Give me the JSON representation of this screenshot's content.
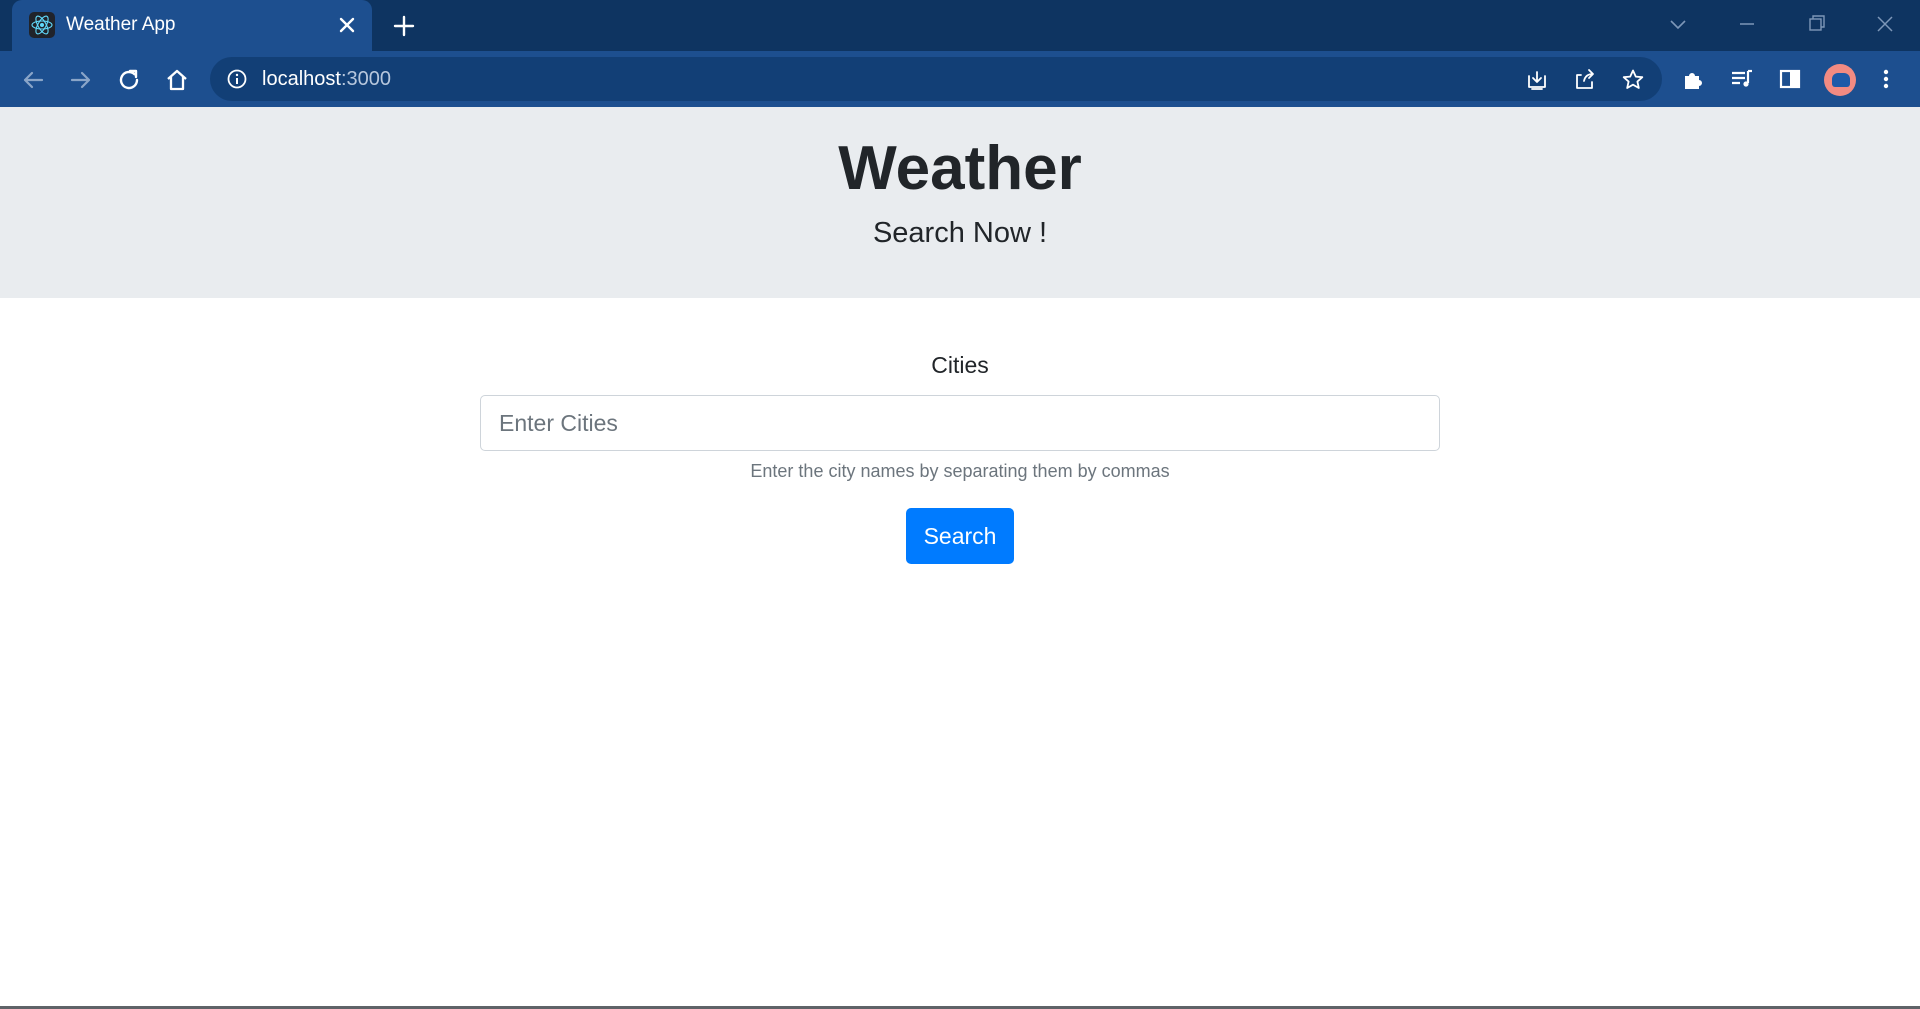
{
  "browser": {
    "tab_title": "Weather App",
    "url_host": "localhost",
    "url_port": ":3000",
    "theme_color": "#1d4f8f"
  },
  "page": {
    "title": "Weather",
    "subtitle": "Search Now !",
    "form": {
      "label": "Cities",
      "input_value": "",
      "input_placeholder": "Enter Cities",
      "help_text": "Enter the city names by separating them by commas",
      "button_label": "Search"
    },
    "colors": {
      "jumbotron_bg": "#e9ecef",
      "primary": "#007bff"
    }
  },
  "icons": {
    "favicon": "react-icon",
    "tab_close": "close-icon",
    "new_tab": "plus-icon",
    "back": "arrow-left-icon",
    "forward": "arrow-right-icon",
    "reload": "reload-icon",
    "home": "home-icon",
    "site_info": "info-icon",
    "install": "install-icon",
    "share": "share-icon",
    "bookmark": "star-icon",
    "extensions": "puzzle-icon",
    "media": "media-queue-icon",
    "side_panel": "side-panel-icon",
    "menu": "kebab-menu-icon"
  }
}
